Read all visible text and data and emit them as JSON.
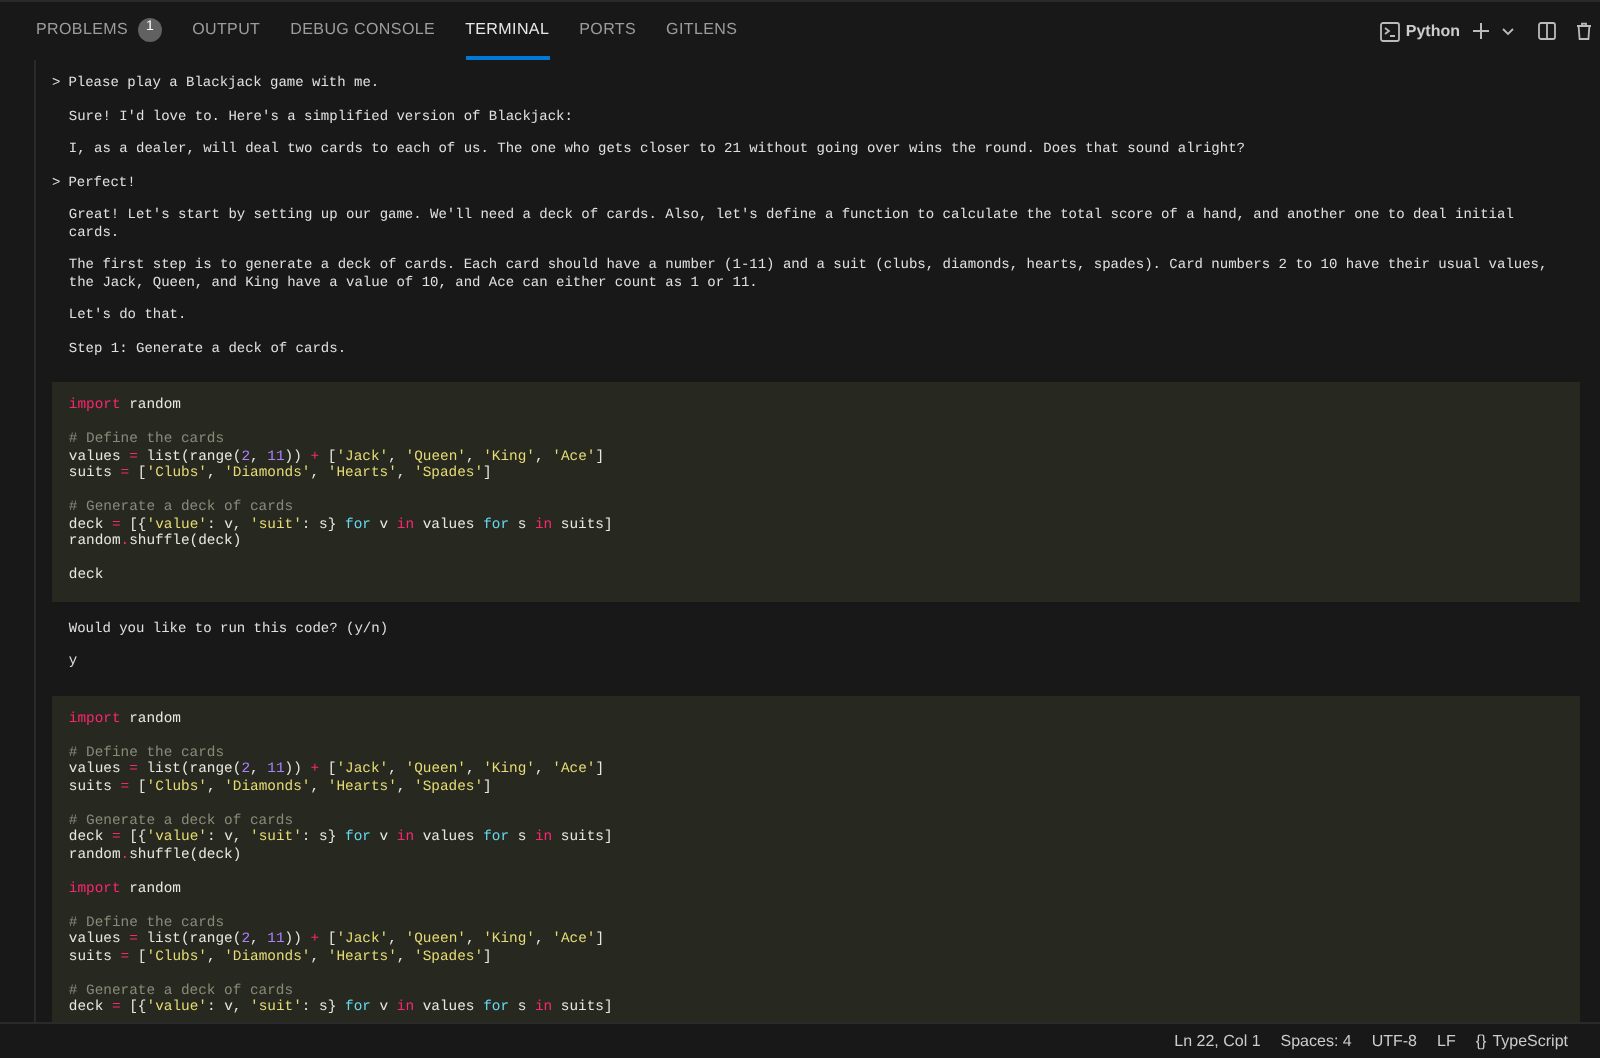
{
  "panel_tabs": [
    {
      "label": "PROBLEMS",
      "badge": "1",
      "selected": false
    },
    {
      "label": "OUTPUT",
      "selected": false
    },
    {
      "label": "DEBUG CONSOLE",
      "selected": false
    },
    {
      "label": "TERMINAL",
      "selected": true
    },
    {
      "label": "PORTS",
      "selected": false
    },
    {
      "label": "GITLENS",
      "selected": false
    }
  ],
  "terminal_profile": "Python",
  "transcript": [
    {
      "kind": "prompt",
      "marker": ">",
      "text": "Please play a Blackjack game with me."
    },
    {
      "kind": "text",
      "text": "Sure! I'd love to. Here's a simplified version of Blackjack:"
    },
    {
      "kind": "text",
      "text": "I, as a dealer, will deal two cards to each of us. The one who gets closer to 21 without going over wins the round. Does that sound alright?"
    },
    {
      "kind": "prompt",
      "marker": ">",
      "text": "Perfect!"
    },
    {
      "kind": "text",
      "text": "Great! Let's start by setting up our game. We'll need a deck of cards. Also, let's define a function to calculate the total score of a hand, and another one to deal initial cards."
    },
    {
      "kind": "text",
      "text": "The first step is to generate a deck of cards. Each card should have a number (1-11) and a suit (clubs, diamonds, hearts, spades). Card numbers 2 to 10 have their usual values, the Jack, Queen, and King have a value of 10, and Ace can either count as 1 or 11."
    },
    {
      "kind": "text",
      "text": "Let's do that."
    },
    {
      "kind": "text",
      "text": "Step 1: Generate a deck of cards."
    },
    {
      "kind": "code",
      "lines": [
        {
          "tokens": [
            {
              "kind": "keyword",
              "text": "import"
            },
            {
              "kind": "plain",
              "text": " random"
            }
          ]
        },
        {
          "blank_before": true,
          "tokens": [
            {
              "kind": "comment",
              "text": "# Define the cards"
            }
          ]
        },
        {
          "tokens": [
            {
              "kind": "plain",
              "text": "values "
            },
            {
              "kind": "operator",
              "text": "="
            },
            {
              "kind": "plain",
              "text": " list(range("
            },
            {
              "kind": "number",
              "text": "2"
            },
            {
              "kind": "plain",
              "text": ", "
            },
            {
              "kind": "number",
              "text": "11"
            },
            {
              "kind": "plain",
              "text": ")) "
            },
            {
              "kind": "operator",
              "text": "+"
            },
            {
              "kind": "plain",
              "text": " ["
            },
            {
              "kind": "string",
              "text": "'Jack'"
            },
            {
              "kind": "plain",
              "text": ", "
            },
            {
              "kind": "string",
              "text": "'Queen'"
            },
            {
              "kind": "plain",
              "text": ", "
            },
            {
              "kind": "string",
              "text": "'King'"
            },
            {
              "kind": "plain",
              "text": ", "
            },
            {
              "kind": "string",
              "text": "'Ace'"
            },
            {
              "kind": "plain",
              "text": "]"
            }
          ]
        },
        {
          "tokens": [
            {
              "kind": "plain",
              "text": "suits "
            },
            {
              "kind": "operator",
              "text": "="
            },
            {
              "kind": "plain",
              "text": " ["
            },
            {
              "kind": "string",
              "text": "'Clubs'"
            },
            {
              "kind": "plain",
              "text": ", "
            },
            {
              "kind": "string",
              "text": "'Diamonds'"
            },
            {
              "kind": "plain",
              "text": ", "
            },
            {
              "kind": "string",
              "text": "'Hearts'"
            },
            {
              "kind": "plain",
              "text": ", "
            },
            {
              "kind": "string",
              "text": "'Spades'"
            },
            {
              "kind": "plain",
              "text": "]"
            }
          ]
        },
        {
          "blank_before": true,
          "tokens": [
            {
              "kind": "comment",
              "text": "# Generate a deck of cards"
            }
          ]
        },
        {
          "tokens": [
            {
              "kind": "plain",
              "text": "deck "
            },
            {
              "kind": "operator",
              "text": "="
            },
            {
              "kind": "plain",
              "text": " [{"
            },
            {
              "kind": "string",
              "text": "'value'"
            },
            {
              "kind": "plain",
              "text": ": v, "
            },
            {
              "kind": "string",
              "text": "'suit'"
            },
            {
              "kind": "plain",
              "text": ": s} "
            },
            {
              "kind": "loop",
              "text": "for"
            },
            {
              "kind": "plain",
              "text": " v "
            },
            {
              "kind": "operator",
              "text": "in"
            },
            {
              "kind": "plain",
              "text": " values "
            },
            {
              "kind": "loop",
              "text": "for"
            },
            {
              "kind": "plain",
              "text": " s "
            },
            {
              "kind": "operator",
              "text": "in"
            },
            {
              "kind": "plain",
              "text": " suits]"
            }
          ]
        },
        {
          "tokens": [
            {
              "kind": "plain",
              "text": "random"
            },
            {
              "kind": "operator",
              "text": "."
            },
            {
              "kind": "plain",
              "text": "shuffle(deck)"
            }
          ]
        },
        {
          "blank_before": true,
          "tokens": [
            {
              "kind": "plain",
              "text": "deck"
            }
          ]
        }
      ]
    },
    {
      "kind": "text",
      "text": "Would you like to run this code? (y/n)"
    },
    {
      "kind": "text",
      "text": "y"
    },
    {
      "kind": "code",
      "lines": [
        {
          "tokens": [
            {
              "kind": "keyword",
              "text": "import"
            },
            {
              "kind": "plain",
              "text": " random"
            }
          ]
        },
        {
          "blank_before": true,
          "tokens": [
            {
              "kind": "comment",
              "text": "# Define the cards"
            }
          ]
        },
        {
          "tokens": [
            {
              "kind": "plain",
              "text": "values "
            },
            {
              "kind": "operator",
              "text": "="
            },
            {
              "kind": "plain",
              "text": " list(range("
            },
            {
              "kind": "number",
              "text": "2"
            },
            {
              "kind": "plain",
              "text": ", "
            },
            {
              "kind": "number",
              "text": "11"
            },
            {
              "kind": "plain",
              "text": ")) "
            },
            {
              "kind": "operator",
              "text": "+"
            },
            {
              "kind": "plain",
              "text": " ["
            },
            {
              "kind": "string",
              "text": "'Jack'"
            },
            {
              "kind": "plain",
              "text": ", "
            },
            {
              "kind": "string",
              "text": "'Queen'"
            },
            {
              "kind": "plain",
              "text": ", "
            },
            {
              "kind": "string",
              "text": "'King'"
            },
            {
              "kind": "plain",
              "text": ", "
            },
            {
              "kind": "string",
              "text": "'Ace'"
            },
            {
              "kind": "plain",
              "text": "]"
            }
          ]
        },
        {
          "tokens": [
            {
              "kind": "plain",
              "text": "suits "
            },
            {
              "kind": "operator",
              "text": "="
            },
            {
              "kind": "plain",
              "text": " ["
            },
            {
              "kind": "string",
              "text": "'Clubs'"
            },
            {
              "kind": "plain",
              "text": ", "
            },
            {
              "kind": "string",
              "text": "'Diamonds'"
            },
            {
              "kind": "plain",
              "text": ", "
            },
            {
              "kind": "string",
              "text": "'Hearts'"
            },
            {
              "kind": "plain",
              "text": ", "
            },
            {
              "kind": "string",
              "text": "'Spades'"
            },
            {
              "kind": "plain",
              "text": "]"
            }
          ]
        },
        {
          "blank_before": true,
          "tokens": [
            {
              "kind": "comment",
              "text": "# Generate a deck of cards"
            }
          ]
        },
        {
          "tokens": [
            {
              "kind": "plain",
              "text": "deck "
            },
            {
              "kind": "operator",
              "text": "="
            },
            {
              "kind": "plain",
              "text": " [{"
            },
            {
              "kind": "string",
              "text": "'value'"
            },
            {
              "kind": "plain",
              "text": ": v, "
            },
            {
              "kind": "string",
              "text": "'suit'"
            },
            {
              "kind": "plain",
              "text": ": s} "
            },
            {
              "kind": "loop",
              "text": "for"
            },
            {
              "kind": "plain",
              "text": " v "
            },
            {
              "kind": "operator",
              "text": "in"
            },
            {
              "kind": "plain",
              "text": " values "
            },
            {
              "kind": "loop",
              "text": "for"
            },
            {
              "kind": "plain",
              "text": " s "
            },
            {
              "kind": "operator",
              "text": "in"
            },
            {
              "kind": "plain",
              "text": " suits]"
            }
          ]
        },
        {
          "tokens": [
            {
              "kind": "plain",
              "text": "random"
            },
            {
              "kind": "operator",
              "text": "."
            },
            {
              "kind": "plain",
              "text": "shuffle(deck)"
            }
          ]
        },
        {
          "blank_before": true,
          "tokens": [
            {
              "kind": "keyword",
              "text": "import"
            },
            {
              "kind": "plain",
              "text": " random"
            }
          ]
        },
        {
          "blank_before": true,
          "tokens": [
            {
              "kind": "comment",
              "text": "# Define the cards"
            }
          ]
        },
        {
          "tokens": [
            {
              "kind": "plain",
              "text": "values "
            },
            {
              "kind": "operator",
              "text": "="
            },
            {
              "kind": "plain",
              "text": " list(range("
            },
            {
              "kind": "number",
              "text": "2"
            },
            {
              "kind": "plain",
              "text": ", "
            },
            {
              "kind": "number",
              "text": "11"
            },
            {
              "kind": "plain",
              "text": ")) "
            },
            {
              "kind": "operator",
              "text": "+"
            },
            {
              "kind": "plain",
              "text": " ["
            },
            {
              "kind": "string",
              "text": "'Jack'"
            },
            {
              "kind": "plain",
              "text": ", "
            },
            {
              "kind": "string",
              "text": "'Queen'"
            },
            {
              "kind": "plain",
              "text": ", "
            },
            {
              "kind": "string",
              "text": "'King'"
            },
            {
              "kind": "plain",
              "text": ", "
            },
            {
              "kind": "string",
              "text": "'Ace'"
            },
            {
              "kind": "plain",
              "text": "]"
            }
          ]
        },
        {
          "tokens": [
            {
              "kind": "plain",
              "text": "suits "
            },
            {
              "kind": "operator",
              "text": "="
            },
            {
              "kind": "plain",
              "text": " ["
            },
            {
              "kind": "string",
              "text": "'Clubs'"
            },
            {
              "kind": "plain",
              "text": ", "
            },
            {
              "kind": "string",
              "text": "'Diamonds'"
            },
            {
              "kind": "plain",
              "text": ", "
            },
            {
              "kind": "string",
              "text": "'Hearts'"
            },
            {
              "kind": "plain",
              "text": ", "
            },
            {
              "kind": "string",
              "text": "'Spades'"
            },
            {
              "kind": "plain",
              "text": "]"
            }
          ]
        },
        {
          "blank_before": true,
          "tokens": [
            {
              "kind": "comment",
              "text": "# Generate a deck of cards"
            }
          ]
        },
        {
          "tokens": [
            {
              "kind": "plain",
              "text": "deck "
            },
            {
              "kind": "operator",
              "text": "="
            },
            {
              "kind": "plain",
              "text": " [{"
            },
            {
              "kind": "string",
              "text": "'value'"
            },
            {
              "kind": "plain",
              "text": ": v, "
            },
            {
              "kind": "string",
              "text": "'suit'"
            },
            {
              "kind": "plain",
              "text": ": s} "
            },
            {
              "kind": "loop",
              "text": "for"
            },
            {
              "kind": "plain",
              "text": " v "
            },
            {
              "kind": "operator",
              "text": "in"
            },
            {
              "kind": "plain",
              "text": " values "
            },
            {
              "kind": "loop",
              "text": "for"
            },
            {
              "kind": "plain",
              "text": " s "
            },
            {
              "kind": "operator",
              "text": "in"
            },
            {
              "kind": "plain",
              "text": " suits]"
            }
          ]
        }
      ]
    }
  ],
  "status_bar": {
    "position": "Ln 22, Col 1",
    "indentation": "Spaces: 4",
    "encoding": "UTF-8",
    "line_ending": "LF",
    "language_icon": "{}",
    "language": "TypeScript"
  }
}
